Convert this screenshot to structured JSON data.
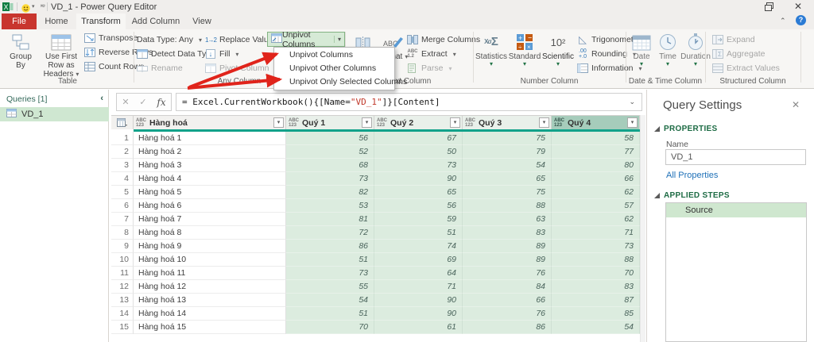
{
  "window": {
    "title": "VD_1 - Power Query Editor"
  },
  "tabs": {
    "items": [
      "File",
      "Home",
      "Transform",
      "Add Column",
      "View"
    ],
    "active": "Transform"
  },
  "ribbon": {
    "table": {
      "label": "Table",
      "group_by": "Group By",
      "first_row": "Use First Row as Headers",
      "transpose": "Transpose",
      "reverse_rows": "Reverse Rows",
      "count_rows": "Count Rows"
    },
    "any_column": {
      "label": "Any Column",
      "data_type": "Data Type: Any",
      "detect": "Detect Data Type",
      "rename": "Rename",
      "replace_values": "Replace Values",
      "fill": "Fill",
      "pivot": "Pivot Column",
      "unpivot": "Unpivot Columns"
    },
    "text_column": {
      "label": "Text Column",
      "split": "Split Column",
      "format": "Format",
      "merge": "Merge Columns",
      "extract": "Extract",
      "parse": "Parse"
    },
    "number_column": {
      "label": "Number Column",
      "statistics": "Statistics",
      "standard": "Standard",
      "scientific": "Scientific",
      "trigonometry": "Trigonometry",
      "rounding": "Rounding",
      "information": "Information"
    },
    "datetime_column": {
      "label": "Date & Time Column",
      "date": "Date",
      "time": "Time",
      "duration": "Duration"
    },
    "structured_column": {
      "label": "Structured Column",
      "expand": "Expand",
      "aggregate": "Aggregate",
      "extract_values": "Extract Values"
    }
  },
  "unpivot_menu": {
    "items": [
      "Unpivot Columns",
      "Unpivot Other Columns",
      "Unpivot Only Selected Columns"
    ]
  },
  "queries_pane": {
    "header": "Queries [1]",
    "query_name": "VD_1"
  },
  "formula_bar": {
    "prefix": "= Excel.CurrentWorkbook(){[Name=",
    "string": "\"VD_1\"",
    "suffix": "]}[Content]"
  },
  "grid": {
    "badge_abc": "ABC",
    "badge_num": "123",
    "columns": [
      "Hàng hoá",
      "Quý 1",
      "Quý 2",
      "Quý 3",
      "Quý 4"
    ],
    "rows": [
      {
        "n": "1",
        "name": "Hàng hoá 1",
        "q1": "56",
        "q2": "67",
        "q3": "75",
        "q4": "58"
      },
      {
        "n": "2",
        "name": "Hàng hoá 2",
        "q1": "52",
        "q2": "50",
        "q3": "79",
        "q4": "77"
      },
      {
        "n": "3",
        "name": "Hàng hoá 3",
        "q1": "68",
        "q2": "73",
        "q3": "54",
        "q4": "80"
      },
      {
        "n": "4",
        "name": "Hàng hoá 4",
        "q1": "73",
        "q2": "90",
        "q3": "65",
        "q4": "66"
      },
      {
        "n": "5",
        "name": "Hàng hoá 5",
        "q1": "82",
        "q2": "65",
        "q3": "75",
        "q4": "62"
      },
      {
        "n": "6",
        "name": "Hàng hoá 6",
        "q1": "53",
        "q2": "56",
        "q3": "88",
        "q4": "57"
      },
      {
        "n": "7",
        "name": "Hàng hoá 7",
        "q1": "81",
        "q2": "59",
        "q3": "63",
        "q4": "62"
      },
      {
        "n": "8",
        "name": "Hàng hoá 8",
        "q1": "72",
        "q2": "51",
        "q3": "83",
        "q4": "71"
      },
      {
        "n": "9",
        "name": "Hàng hoá 9",
        "q1": "86",
        "q2": "74",
        "q3": "89",
        "q4": "73"
      },
      {
        "n": "10",
        "name": "Hàng hoá 10",
        "q1": "51",
        "q2": "69",
        "q3": "89",
        "q4": "88"
      },
      {
        "n": "11",
        "name": "Hàng hoá 11",
        "q1": "73",
        "q2": "64",
        "q3": "76",
        "q4": "70"
      },
      {
        "n": "12",
        "name": "Hàng hoá 12",
        "q1": "55",
        "q2": "71",
        "q3": "84",
        "q4": "83"
      },
      {
        "n": "13",
        "name": "Hàng hoá 13",
        "q1": "54",
        "q2": "90",
        "q3": "66",
        "q4": "87"
      },
      {
        "n": "14",
        "name": "Hàng hoá 14",
        "q1": "51",
        "q2": "90",
        "q3": "76",
        "q4": "85"
      },
      {
        "n": "15",
        "name": "Hàng hoá 15",
        "q1": "70",
        "q2": "61",
        "q3": "86",
        "q4": "54"
      }
    ]
  },
  "settings": {
    "title": "Query Settings",
    "properties_label": "PROPERTIES",
    "name_label": "Name",
    "name_value": "VD_1",
    "all_properties": "All Properties",
    "applied_steps_label": "APPLIED STEPS",
    "steps": [
      "Source"
    ]
  },
  "colors": {
    "file_tab_red": "#c8352e",
    "accent_green": "#217346",
    "selection_green": "#dcecdf",
    "selected_header_green": "#a6ccbb",
    "quality_bar_teal": "#12a28a",
    "annotation_arrow_red": "#e0241b",
    "link_blue": "#2071b8"
  }
}
